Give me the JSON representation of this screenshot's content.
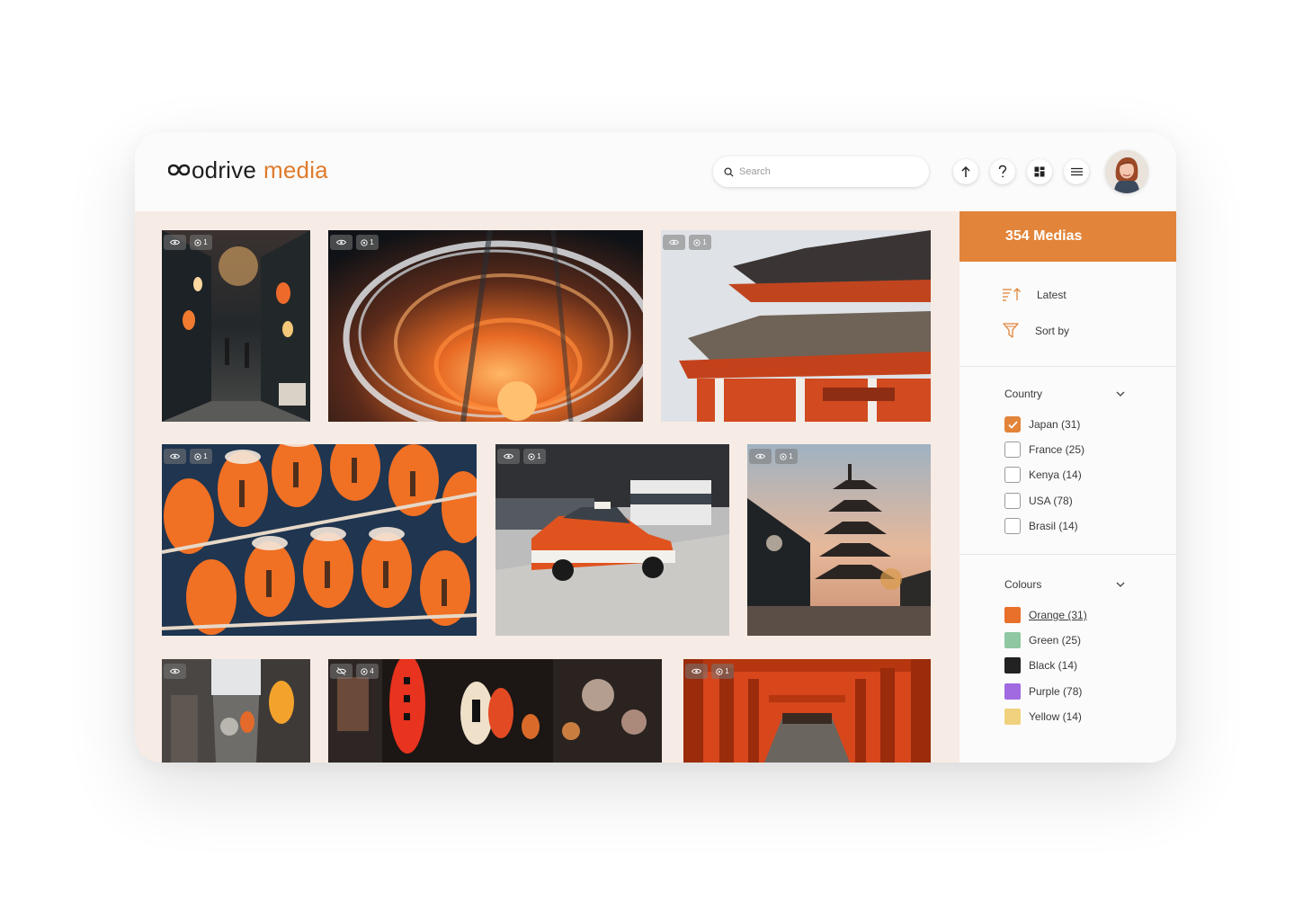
{
  "header": {
    "brand": "odrive",
    "product": "media",
    "search_placeholder": "Search",
    "icons": [
      "upload-icon",
      "help-icon",
      "grid-icon",
      "menu-icon"
    ]
  },
  "gallery": {
    "tiles": [
      {
        "name": "alley-lanterns",
        "count": "1",
        "hidden": false
      },
      {
        "name": "light-trails",
        "count": "1",
        "hidden": false
      },
      {
        "name": "temple-roof",
        "count": "1",
        "hidden": false
      },
      {
        "name": "paper-lanterns",
        "count": "1",
        "hidden": false
      },
      {
        "name": "red-taxi",
        "count": "1",
        "hidden": false
      },
      {
        "name": "pagoda-street",
        "count": "1",
        "hidden": false
      },
      {
        "name": "narrow-alley",
        "count": "",
        "hidden": false
      },
      {
        "name": "night-market",
        "count": "4",
        "hidden": true
      },
      {
        "name": "torii-gates",
        "count": "1",
        "hidden": false
      }
    ]
  },
  "sidebar": {
    "media_count": "354 Medias",
    "sort": {
      "latest": "Latest",
      "sort_by": "Sort by"
    },
    "country": {
      "title": "Country",
      "options": [
        {
          "label": "Japan (31)",
          "checked": true
        },
        {
          "label": "France (25)",
          "checked": false
        },
        {
          "label": "Kenya (14)",
          "checked": false
        },
        {
          "label": "USA (78)",
          "checked": false
        },
        {
          "label": "Brasil (14)",
          "checked": false
        }
      ]
    },
    "colours": {
      "title": "Colours",
      "options": [
        {
          "label": "Orange (31)",
          "color": "#e8702a",
          "active": true
        },
        {
          "label": "Green (25)",
          "color": "#8ec7a2",
          "active": false
        },
        {
          "label": "Black (14)",
          "color": "#222222",
          "active": false
        },
        {
          "label": "Purple (78)",
          "color": "#a16ae0",
          "active": false
        },
        {
          "label": "Yellow (14)",
          "color": "#f0d27e",
          "active": false
        }
      ]
    }
  },
  "colors": {
    "accent": "#e28439",
    "gallery_bg": "#f7ebe5"
  }
}
